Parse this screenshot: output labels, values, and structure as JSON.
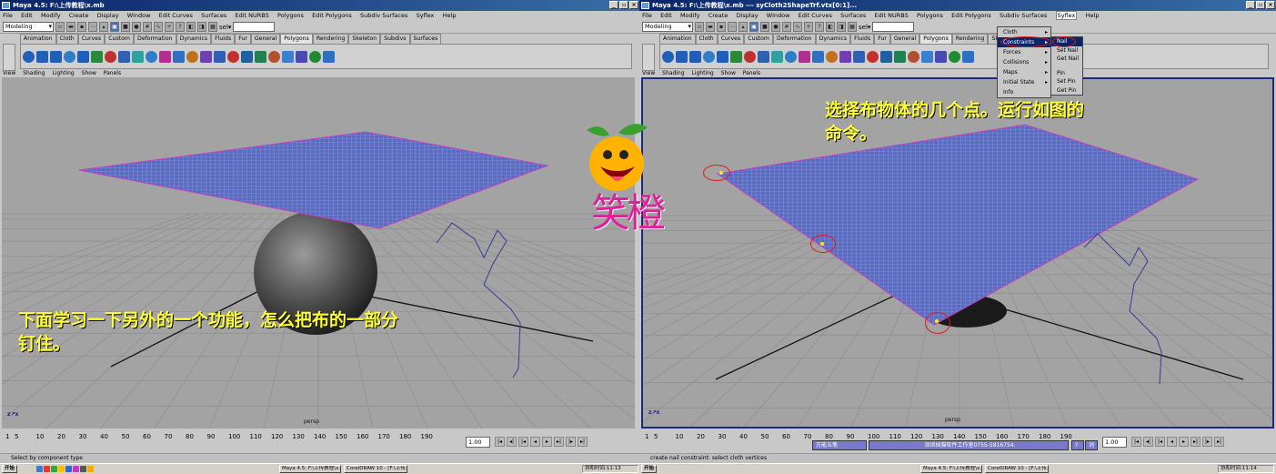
{
  "left": {
    "title": "Maya 4.5: F:\\上传教程\\x.mb",
    "menu": [
      "File",
      "Edit",
      "Modify",
      "Create",
      "Display",
      "Window",
      "Edit Curves",
      "Surfaces",
      "Edit NURBS",
      "Polygons",
      "Edit Polygons",
      "Subdiv Surfaces",
      "Syflex",
      "Help"
    ],
    "mode": "Modeling",
    "sel_label": "sel▾",
    "shelf_tabs": [
      "Animation",
      "Cloth",
      "Curves",
      "Custom",
      "Deformation",
      "Dynamics",
      "Fluids",
      "Fur",
      "General",
      "Polygons",
      "Rendering",
      "Skeleton",
      "Subdivs",
      "Surfaces"
    ],
    "active_tab": "Polygons",
    "panel_menu": [
      "View",
      "Shading",
      "Lighting",
      "Show",
      "Panels"
    ],
    "caption": "下面学习一下另外的一个功能，怎么把布的一部分钉住。",
    "caption_l1": "下面学习一下另外的一个功能，怎么把布的一部分",
    "caption_l2": "钉住。",
    "camera": "persp",
    "timeline_ticks": [
      "1",
      "5",
      "10",
      "20",
      "30",
      "40",
      "50",
      "60",
      "70",
      "80",
      "90",
      "100",
      "110",
      "120",
      "130",
      "140",
      "150",
      "160",
      "170",
      "180",
      "190"
    ],
    "current_frame": "1.00",
    "help_text": "Select by component type"
  },
  "right": {
    "title": "Maya 4.5: F:\\上传教程\\x.mb  ---  syCloth2ShapeTrf.vtx[0:1]...",
    "menu": [
      "File",
      "Edit",
      "Modify",
      "Create",
      "Display",
      "Window",
      "Edit Curves",
      "Surfaces",
      "Edit NURBS",
      "Polygons",
      "Edit Polygons",
      "Subdiv Surfaces",
      "Syflex",
      "Help"
    ],
    "mode": "Modeling",
    "sel_label": "sel▾",
    "shelf_tabs": [
      "Animation",
      "Cloth",
      "Curves",
      "Custom",
      "Deformation",
      "Dynamics",
      "Fluids",
      "Fur",
      "General",
      "Polygons",
      "Rendering",
      "Skeleton"
    ],
    "active_tab": "Polygons",
    "panel_menu": [
      "View",
      "Shading",
      "Lighting",
      "Show",
      "Panels"
    ],
    "caption_l1": "选择布物体的几个点。运行如图的",
    "caption_l2": "命令。",
    "camera": "persp",
    "timeline_ticks": [
      "1",
      "5",
      "10",
      "20",
      "30",
      "40",
      "50",
      "60",
      "70",
      "80",
      "90",
      "100",
      "110",
      "120",
      "130",
      "140",
      "150",
      "160",
      "170",
      "180",
      "190"
    ],
    "current_frame": "1.00",
    "help_text": "create nail constraint: select cloth vertices",
    "syflex_menu": [
      "Cloth",
      "Constraints",
      "Forces",
      "Collisions",
      "Maps",
      "Initial State",
      "Info"
    ],
    "syflex_selected": "Constraints",
    "constraints_submenu": [
      "Nail",
      "Set Nail",
      "Get Nail",
      "Pin",
      "Set Pin",
      "Get Pin"
    ],
    "nail_selected": "Nail",
    "ime_label": "万能五笔",
    "studio_label": "深圳拙猫软件工作室0755-5816754.",
    "status_q": "?",
    "status_btn": "词"
  },
  "watermark": "笑橙",
  "taskbar": {
    "start": "开始",
    "buttons": [
      "Maya 4.5: F:\\上传教程\\x...",
      "CorelDRAW 10 - [F:\\上传..."
    ],
    "clock": "协和时间:11:13",
    "clock2": "协和时间:11:14"
  }
}
